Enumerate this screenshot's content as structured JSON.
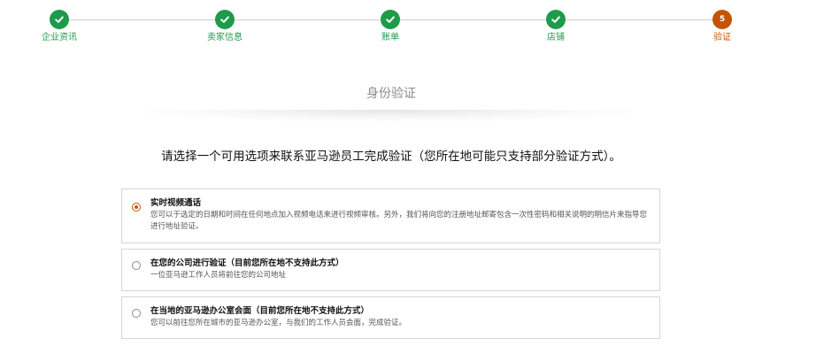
{
  "stepper": {
    "steps": [
      {
        "label": "企业资讯",
        "status": "complete",
        "icon": "check-icon"
      },
      {
        "label": "卖家信息",
        "status": "complete",
        "icon": "check-icon"
      },
      {
        "label": "账单",
        "status": "complete",
        "icon": "check-icon"
      },
      {
        "label": "店铺",
        "status": "complete",
        "icon": "check-icon"
      },
      {
        "label": "验证",
        "status": "current",
        "number": "5"
      }
    ],
    "colors": {
      "complete": "#1e9b4a",
      "current": "#c45500",
      "line": "#cfcfcf"
    }
  },
  "main": {
    "title": "身份验证",
    "instruction": "请选择一个可用选项来联系亚马逊员工完成验证（您所在地可能只支持部分验证方式）。",
    "options": [
      {
        "title": "实时视频通话",
        "description": "您可以于选定的日期和时间在任何地点加入视频电话来进行视频审核。另外，我们将向您的注册地址邮寄包含一次性密码和相关说明的明信片来指导您进行地址验证。",
        "selected": true
      },
      {
        "title": "在您的公司进行验证（目前您所在地不支持此方式）",
        "description": "一位亚马逊工作人员将前往您的公司地址",
        "selected": false
      },
      {
        "title": "在当地的亚马逊办公室会面（目前您所在地不支持此方式）",
        "description": "您可以前往您所在城市的亚马逊办公室，与我们的工作人员会面，完成验证。",
        "selected": false
      }
    ]
  }
}
